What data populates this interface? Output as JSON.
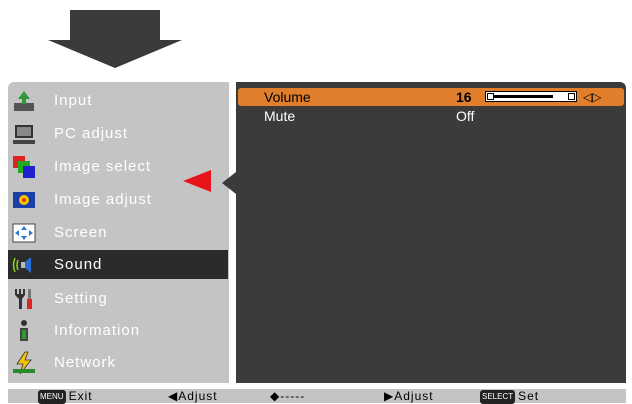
{
  "menu": {
    "items": [
      {
        "label": "Input",
        "icon": "input-icon"
      },
      {
        "label": "PC adjust",
        "icon": "pc-adjust-icon"
      },
      {
        "label": "Image select",
        "icon": "image-select-icon"
      },
      {
        "label": "Image adjust",
        "icon": "image-adjust-icon"
      },
      {
        "label": "Screen",
        "icon": "screen-icon"
      },
      {
        "label": "Sound",
        "icon": "sound-icon",
        "active": true
      },
      {
        "label": "Setting",
        "icon": "setting-icon"
      },
      {
        "label": "Information",
        "icon": "information-icon"
      },
      {
        "label": "Network",
        "icon": "network-icon"
      }
    ]
  },
  "submenu": {
    "volume": {
      "label": "Volume",
      "value": "16",
      "level": 16
    },
    "mute": {
      "label": "Mute",
      "value": "Off"
    }
  },
  "footer": {
    "exit_key": "MENU",
    "exit_label": "Exit",
    "left_label": "◀Adjust",
    "updown_label": "◆-----",
    "right_label": "▶Adjust",
    "select_key": "SELECT",
    "select_label": "Set"
  },
  "colors": {
    "highlight": "#e07e2c",
    "menu_bg": "#c4c4c4",
    "panel_bg": "#3b3b3b",
    "pointer": "#e8141b"
  }
}
